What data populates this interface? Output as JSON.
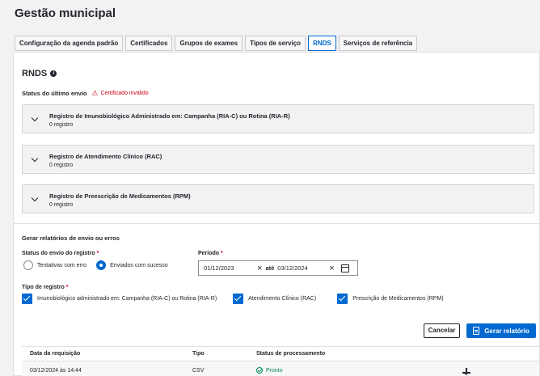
{
  "page": {
    "title": "Gestão municipal"
  },
  "tabs": [
    {
      "label": "Configuração da agenda padrão",
      "active": false
    },
    {
      "label": "Certificados",
      "active": false
    },
    {
      "label": "Grupos de exames",
      "active": false
    },
    {
      "label": "Tipos de serviço",
      "active": false
    },
    {
      "label": "RNDS",
      "active": true
    },
    {
      "label": "Serviços de referência",
      "active": false
    }
  ],
  "rnds": {
    "title": "RNDS",
    "info_icon": "info-icon",
    "status_label": "Status do último envio",
    "status_warning": "Certificado inválido"
  },
  "accordions": [
    {
      "title": "Registro de Imunobiológico Administrado em: Campanha (RIA-C) ou Rotina (RIA-R)",
      "subtitle": "0 registro"
    },
    {
      "title": "Registro de Atendimento Clínico (RAC)",
      "subtitle": "0 registro"
    },
    {
      "title": "Registro de Preescrição de Medicamentos (RPM)",
      "subtitle": "0 registro"
    }
  ],
  "reports": {
    "title": "Gerar relatórios de envio ou erros",
    "status_label": "Status do envio do registro",
    "options": [
      {
        "label": "Tentativas com erro",
        "selected": false
      },
      {
        "label": "Enviados com sucesso",
        "selected": true
      }
    ],
    "period_label": "Período",
    "date_from": "01/12/2023",
    "date_sep": "até",
    "date_to": "03/12/2024",
    "type_label": "Tipo de registro",
    "types": [
      {
        "label": "Imunobiológico administrado em: Campanha (RIA-C) ou Rotina (RIA-R)",
        "checked": true
      },
      {
        "label": "Atendimento Clínico (RAC)",
        "checked": true
      },
      {
        "label": "Prescrição de Medicamentos (RPM)",
        "checked": true
      }
    ],
    "required_mark": "*",
    "cancel_label": "Cancelar",
    "generate_label": "Gerar relatório"
  },
  "table": {
    "headers": [
      "Data da requisição",
      "Tipo",
      "Status de processamento"
    ],
    "rows": [
      {
        "date": "03/12/2024 às 14:44",
        "type": "CSV",
        "status": "Pronto"
      }
    ]
  },
  "colors": {
    "primary": "#0069d0",
    "danger": "#d0021b",
    "success": "#00875a"
  }
}
